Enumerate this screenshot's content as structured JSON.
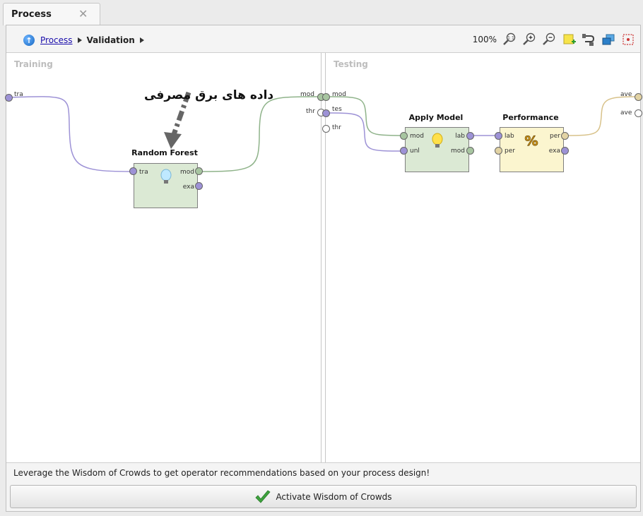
{
  "tab": {
    "title": "Process",
    "close_glyph": "✕"
  },
  "breadcrumb": {
    "link": "Process",
    "current": "Validation"
  },
  "toolbar": {
    "zoom": "100%",
    "icons": [
      "zoom-fit-icon",
      "zoom-in-icon",
      "zoom-out-icon",
      "add-note-icon",
      "auto-wire-icon",
      "arrange-icon",
      "select-all-icon"
    ]
  },
  "training": {
    "title": "Training",
    "input_port": "tra",
    "output_ports": [
      "mod",
      "thr"
    ],
    "annotation": "داده های برق مصرفی",
    "random_forest": {
      "title": "Random Forest",
      "inputs": [
        "tra"
      ],
      "outputs": [
        "mod",
        "exa"
      ]
    }
  },
  "testing": {
    "title": "Testing",
    "input_ports": [
      "mod",
      "tes",
      "thr"
    ],
    "output_ports": [
      "ave",
      "ave"
    ],
    "apply_model": {
      "title": "Apply Model",
      "inputs": [
        "mod",
        "unl"
      ],
      "outputs": [
        "lab",
        "mod"
      ]
    },
    "performance": {
      "title": "Performance",
      "inputs": [
        "lab",
        "per"
      ],
      "outputs": [
        "per",
        "exa"
      ]
    }
  },
  "colors": {
    "wire_example": "#9d92d6",
    "wire_model": "#8fb38a",
    "wire_perf": "#d8c28a"
  },
  "bottom": {
    "message": "Leverage the Wisdom of Crowds to get operator recommendations based on your process design!",
    "button_label": "Activate Wisdom of Crowds"
  }
}
